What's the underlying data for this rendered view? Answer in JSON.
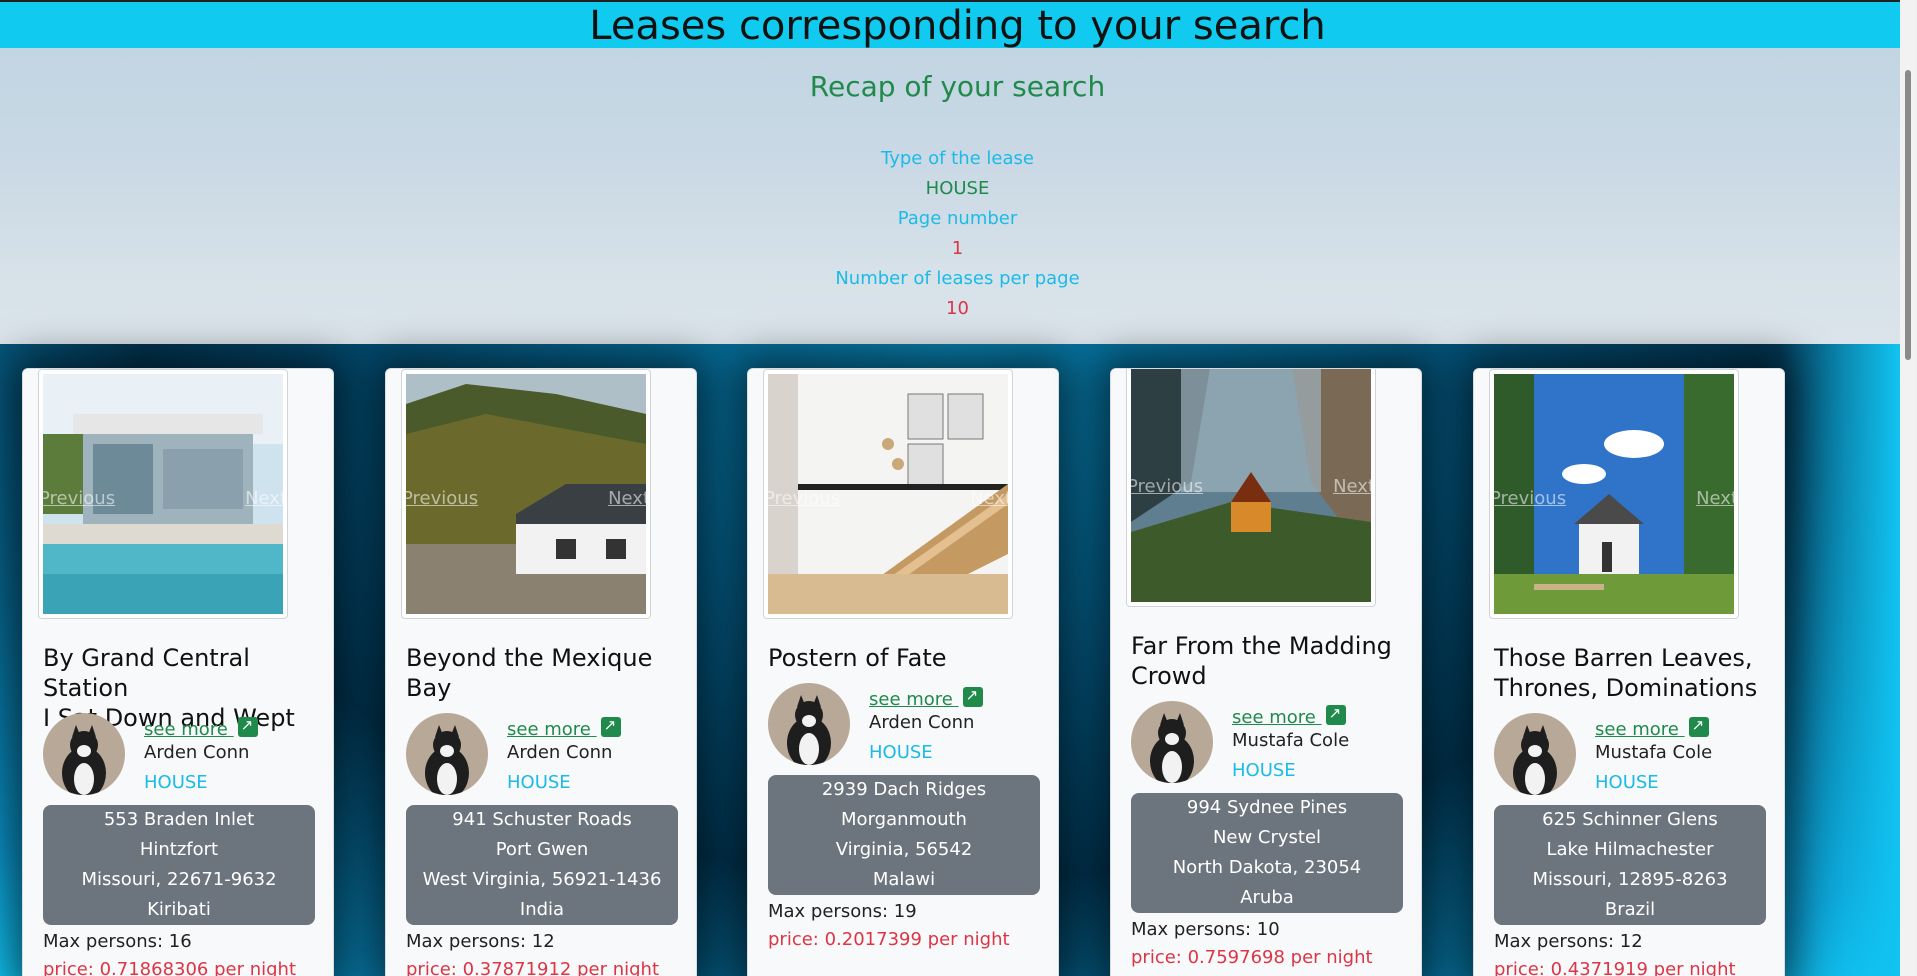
{
  "header": {
    "title": "Leases corresponding to your search"
  },
  "recap": {
    "title": "Recap of your search",
    "type_label": "Type of the lease",
    "type_value": "HOUSE",
    "page_label": "Page number",
    "page_value": "1",
    "per_page_label": "Number of leases per page",
    "per_page_value": "10"
  },
  "carousel": {
    "prev_label": "Previous",
    "next_label": "Next"
  },
  "cards": [
    {
      "title_line1": "By Grand Central Station",
      "title_line2": "I Sat Down and Wept",
      "see_more": "see more",
      "owner": "Arden Conn",
      "type": "HOUSE",
      "street": "553 Braden Inlet",
      "city": "Hintzfort",
      "state_zip": "Missouri, 22671-9632",
      "country": "Kiribati",
      "max_persons": "Max persons: 16",
      "price": "price: 0.71868306 per night"
    },
    {
      "title_line1": "Beyond the Mexique",
      "title_line2": "Bay",
      "see_more": "see more",
      "owner": "Arden Conn",
      "type": "HOUSE",
      "street": "941 Schuster Roads",
      "city": "Port Gwen",
      "state_zip": "West Virginia, 56921-1436",
      "country": "India",
      "max_persons": "Max persons: 12",
      "price": "price: 0.37871912 per night"
    },
    {
      "title_line1": "Postern of Fate",
      "title_line2": "",
      "see_more": "see more",
      "owner": "Arden Conn",
      "type": "HOUSE",
      "street": "2939 Dach Ridges",
      "city": "Morganmouth",
      "state_zip": "Virginia, 56542",
      "country": "Malawi",
      "max_persons": "Max persons: 19",
      "price": "price: 0.2017399 per night"
    },
    {
      "title_line1": "Far From the Madding",
      "title_line2": "Crowd",
      "see_more": "see more",
      "owner": "Mustafa Cole",
      "type": "HOUSE",
      "street": "994 Sydnee Pines",
      "city": "New Crystel",
      "state_zip": "North Dakota, 23054",
      "country": "Aruba",
      "max_persons": "Max persons: 10",
      "price": "price: 0.7597698 per night"
    },
    {
      "title_line1": "Those Barren Leaves,",
      "title_line2": "Thrones, Dominations",
      "see_more": "see more",
      "owner": "Mustafa Cole",
      "type": "HOUSE",
      "street": "625 Schinner Glens",
      "city": "Lake Hilmachester",
      "state_zip": "Missouri, 12895-8263",
      "country": "Brazil",
      "max_persons": "Max persons: 12",
      "price": "price: 0.4371919 per night"
    }
  ]
}
